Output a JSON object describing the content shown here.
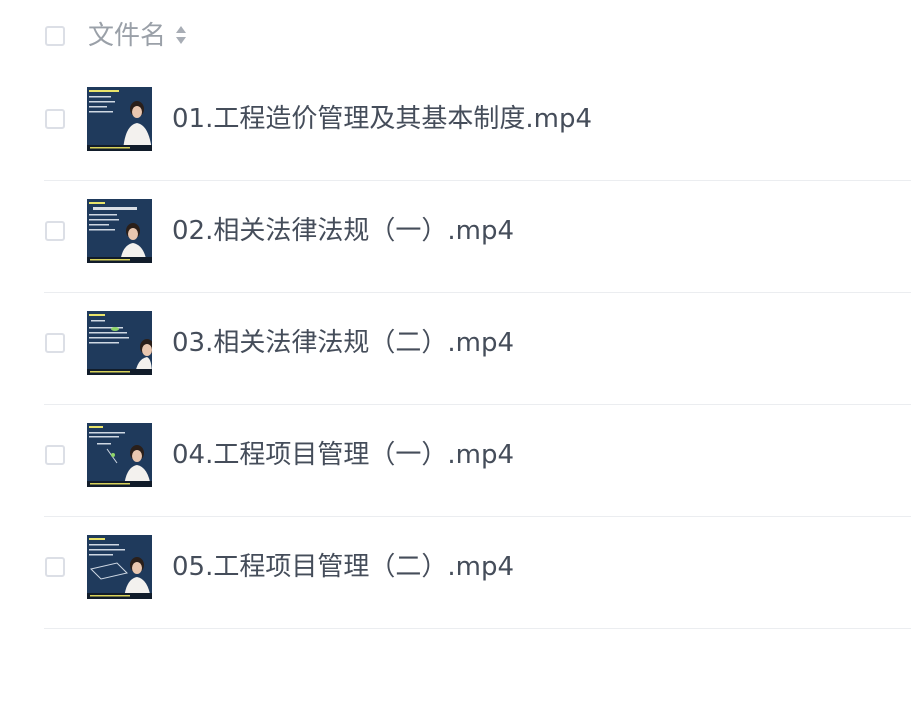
{
  "header": {
    "column_label": "文件名"
  },
  "files": [
    {
      "name": "01.工程造价管理及其基本制度.mp4"
    },
    {
      "name": "02.相关法律法规（一）.mp4"
    },
    {
      "name": "03.相关法律法规（二）.mp4"
    },
    {
      "name": "04.工程项目管理（一）.mp4"
    },
    {
      "name": "05.工程项目管理（二）.mp4"
    }
  ],
  "colors": {
    "text": "#454d5a",
    "header_text": "#9aa0a8",
    "divider": "#ebedf0",
    "checkbox_border": "#dcdfe6",
    "thumb_bg": "#1f3a5c"
  }
}
